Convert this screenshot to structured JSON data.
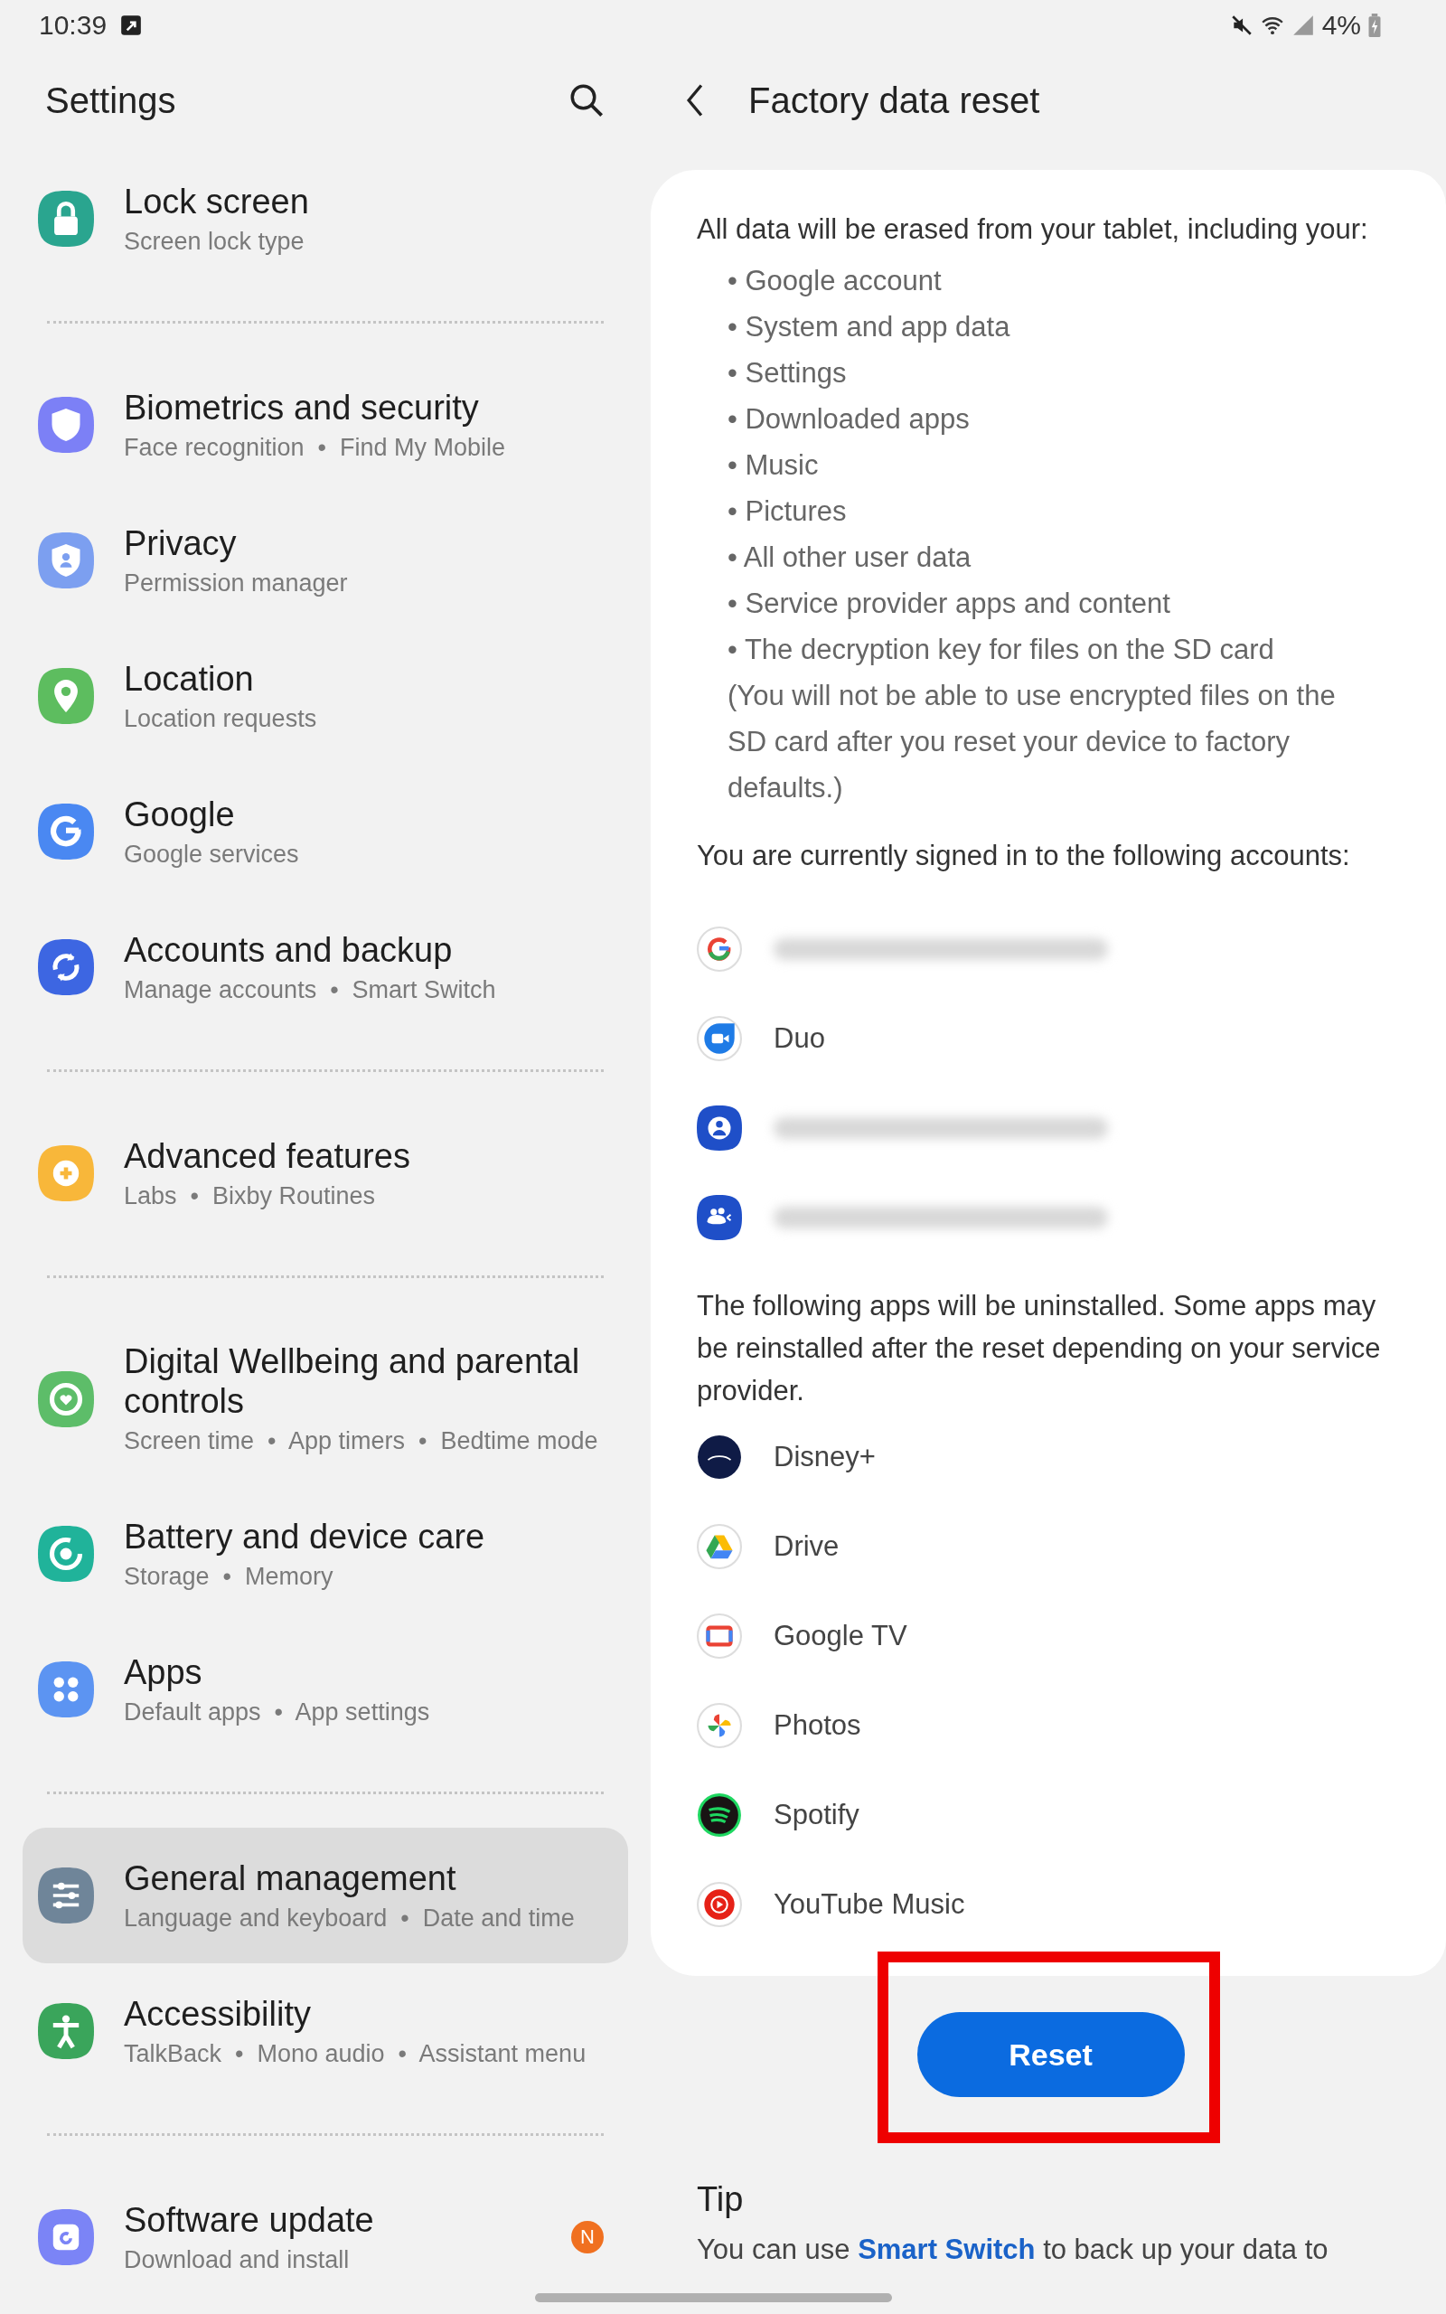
{
  "status_bar": {
    "time": "10:39",
    "battery": "4%"
  },
  "settings": {
    "title": "Settings",
    "groups": [
      [
        {
          "title": "Lock screen",
          "subtitle": "Screen lock type",
          "selected": false
        }
      ],
      [
        {
          "title": "Biometrics and security",
          "subtitle": "Face recognition  •  Find My Mobile",
          "selected": false
        },
        {
          "title": "Privacy",
          "subtitle": "Permission manager",
          "selected": false
        },
        {
          "title": "Location",
          "subtitle": "Location requests",
          "selected": false
        },
        {
          "title": "Google",
          "subtitle": "Google services",
          "selected": false
        },
        {
          "title": "Accounts and backup",
          "subtitle": "Manage accounts  •  Smart Switch",
          "selected": false
        }
      ],
      [
        {
          "title": "Advanced features",
          "subtitle": "Labs  •  Bixby Routines",
          "selected": false
        }
      ],
      [
        {
          "title": "Digital Wellbeing and parental controls",
          "subtitle": "Screen time  •  App timers  •  Bedtime mode",
          "selected": false
        },
        {
          "title": "Battery and device care",
          "subtitle": "Storage  •  Memory",
          "selected": false
        },
        {
          "title": "Apps",
          "subtitle": "Default apps  •  App settings",
          "selected": false
        }
      ],
      [
        {
          "title": "General management",
          "subtitle": "Language and keyboard  •  Date and time",
          "selected": true
        },
        {
          "title": "Accessibility",
          "subtitle": "TalkBack  •  Mono audio  •  Assistant menu",
          "selected": false
        }
      ],
      [
        {
          "title": "Software update",
          "subtitle": "Download and install",
          "selected": false,
          "badge": "N"
        }
      ]
    ]
  },
  "detail": {
    "title": "Factory data reset",
    "intro": "All data will be erased from your tablet, including your:",
    "erased_items": [
      "• Google account",
      "• System and app data",
      "• Settings",
      "• Downloaded apps",
      "• Music",
      "• Pictures",
      "• All other user data",
      "• Service provider apps and content",
      "• The decryption key for files on the SD card"
    ],
    "note": "(You will not be able to use encrypted files on the SD card after you reset your device to factory defaults.)",
    "accounts_heading": "You are currently signed in to the following accounts:",
    "accounts": [
      {
        "kind": "redacted"
      },
      {
        "kind": "named",
        "label": "Duo"
      },
      {
        "kind": "redacted"
      },
      {
        "kind": "redacted"
      }
    ],
    "apps_heading": "The following apps will be uninstalled. Some apps may be reinstalled after the reset depending on your service provider.",
    "apps": [
      "Disney+",
      "Drive",
      "Google TV",
      "Photos",
      "Spotify",
      "YouTube Music"
    ],
    "reset_button": "Reset",
    "tip": {
      "title": "Tip",
      "text_before": "You can use ",
      "link": "Smart Switch",
      "text_after": " to back up your data to"
    }
  }
}
